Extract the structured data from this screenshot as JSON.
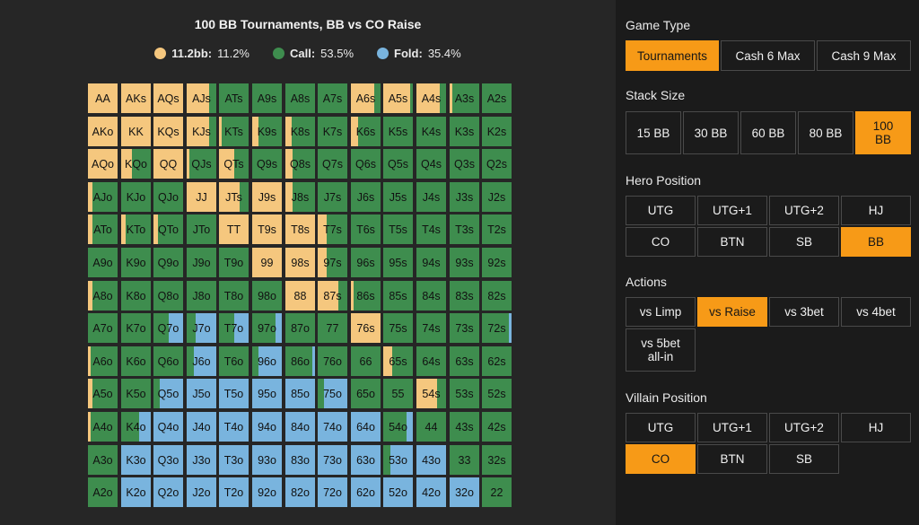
{
  "chart": {
    "title": "100 BB Tournaments, BB vs CO Raise",
    "legend": [
      {
        "name": "11.2bb:",
        "value": "11.2%",
        "color": "#f5c77e"
      },
      {
        "name": "Call:",
        "value": "53.5%",
        "color": "#3e8d4e"
      },
      {
        "name": "Fold:",
        "value": "35.4%",
        "color": "#79b4de"
      }
    ]
  },
  "colors": {
    "raise": "#f5c77e",
    "call": "#3e8d4e",
    "fold": "#79b4de",
    "accent": "#f79a17"
  },
  "grid": [
    [
      {
        "l": "AA",
        "r": 1,
        "c": 0
      },
      {
        "l": "AKs",
        "r": 1,
        "c": 0
      },
      {
        "l": "AQs",
        "r": 1,
        "c": 0
      },
      {
        "l": "AJs",
        "r": 0.75,
        "c": 0.25
      },
      {
        "l": "ATs",
        "r": 0,
        "c": 1
      },
      {
        "l": "A9s",
        "r": 0,
        "c": 1
      },
      {
        "l": "A8s",
        "r": 0,
        "c": 1
      },
      {
        "l": "A7s",
        "r": 0,
        "c": 1
      },
      {
        "l": "A6s",
        "r": 0.8,
        "c": 0.2
      },
      {
        "l": "A5s",
        "r": 0.9,
        "c": 0.1
      },
      {
        "l": "A4s",
        "r": 0.8,
        "c": 0.2
      },
      {
        "l": "A3s",
        "r": 0.1,
        "c": 0.9
      },
      {
        "l": "A2s",
        "r": 0,
        "c": 1
      }
    ],
    [
      {
        "l": "AKo",
        "r": 1,
        "c": 0
      },
      {
        "l": "KK",
        "r": 1,
        "c": 0
      },
      {
        "l": "KQs",
        "r": 1,
        "c": 0
      },
      {
        "l": "KJs",
        "r": 0.75,
        "c": 0.25
      },
      {
        "l": "KTs",
        "r": 0.1,
        "c": 0.9
      },
      {
        "l": "K9s",
        "r": 0.2,
        "c": 0.8
      },
      {
        "l": "K8s",
        "r": 0.2,
        "c": 0.8
      },
      {
        "l": "K7s",
        "r": 0,
        "c": 1
      },
      {
        "l": "K6s",
        "r": 0.25,
        "c": 0.75
      },
      {
        "l": "K5s",
        "r": 0,
        "c": 1
      },
      {
        "l": "K4s",
        "r": 0,
        "c": 1
      },
      {
        "l": "K3s",
        "r": 0,
        "c": 1
      },
      {
        "l": "K2s",
        "r": 0,
        "c": 1
      }
    ],
    [
      {
        "l": "AQo",
        "r": 1,
        "c": 0
      },
      {
        "l": "KQo",
        "r": 0.35,
        "c": 0.65
      },
      {
        "l": "QQ",
        "r": 1,
        "c": 0
      },
      {
        "l": "QJs",
        "r": 0.1,
        "c": 0.9
      },
      {
        "l": "QTs",
        "r": 0.5,
        "c": 0.5
      },
      {
        "l": "Q9s",
        "r": 0,
        "c": 1
      },
      {
        "l": "Q8s",
        "r": 0.25,
        "c": 0.75
      },
      {
        "l": "Q7s",
        "r": 0,
        "c": 1
      },
      {
        "l": "Q6s",
        "r": 0,
        "c": 1
      },
      {
        "l": "Q5s",
        "r": 0,
        "c": 1
      },
      {
        "l": "Q4s",
        "r": 0,
        "c": 1
      },
      {
        "l": "Q3s",
        "r": 0,
        "c": 1
      },
      {
        "l": "Q2s",
        "r": 0,
        "c": 1
      }
    ],
    [
      {
        "l": "AJo",
        "r": 0.15,
        "c": 0.85
      },
      {
        "l": "KJo",
        "r": 0,
        "c": 1
      },
      {
        "l": "QJo",
        "r": 0,
        "c": 1
      },
      {
        "l": "JJ",
        "r": 1,
        "c": 0
      },
      {
        "l": "JTs",
        "r": 0.7,
        "c": 0.3
      },
      {
        "l": "J9s",
        "r": 1,
        "c": 0
      },
      {
        "l": "J8s",
        "r": 0.25,
        "c": 0.75
      },
      {
        "l": "J7s",
        "r": 0,
        "c": 1
      },
      {
        "l": "J6s",
        "r": 0,
        "c": 1
      },
      {
        "l": "J5s",
        "r": 0,
        "c": 1
      },
      {
        "l": "J4s",
        "r": 0,
        "c": 1
      },
      {
        "l": "J3s",
        "r": 0,
        "c": 1
      },
      {
        "l": "J2s",
        "r": 0,
        "c": 1
      }
    ],
    [
      {
        "l": "ATo",
        "r": 0.15,
        "c": 0.85
      },
      {
        "l": "KTo",
        "r": 0.15,
        "c": 0.85
      },
      {
        "l": "QTo",
        "r": 0.15,
        "c": 0.85
      },
      {
        "l": "JTo",
        "r": 0,
        "c": 1
      },
      {
        "l": "TT",
        "r": 1,
        "c": 0
      },
      {
        "l": "T9s",
        "r": 1,
        "c": 0
      },
      {
        "l": "T8s",
        "r": 1,
        "c": 0
      },
      {
        "l": "T7s",
        "r": 0.3,
        "c": 0.7
      },
      {
        "l": "T6s",
        "r": 0,
        "c": 1
      },
      {
        "l": "T5s",
        "r": 0,
        "c": 1
      },
      {
        "l": "T4s",
        "r": 0,
        "c": 1
      },
      {
        "l": "T3s",
        "r": 0,
        "c": 1
      },
      {
        "l": "T2s",
        "r": 0,
        "c": 1
      }
    ],
    [
      {
        "l": "A9o",
        "r": 0,
        "c": 1
      },
      {
        "l": "K9o",
        "r": 0,
        "c": 1
      },
      {
        "l": "Q9o",
        "r": 0,
        "c": 1
      },
      {
        "l": "J9o",
        "r": 0,
        "c": 1
      },
      {
        "l": "T9o",
        "r": 0,
        "c": 1
      },
      {
        "l": "99",
        "r": 1,
        "c": 0
      },
      {
        "l": "98s",
        "r": 1,
        "c": 0
      },
      {
        "l": "97s",
        "r": 0.3,
        "c": 0.7
      },
      {
        "l": "96s",
        "r": 0,
        "c": 1
      },
      {
        "l": "95s",
        "r": 0,
        "c": 1
      },
      {
        "l": "94s",
        "r": 0,
        "c": 1
      },
      {
        "l": "93s",
        "r": 0,
        "c": 1
      },
      {
        "l": "92s",
        "r": 0,
        "c": 1
      }
    ],
    [
      {
        "l": "A8o",
        "r": 0.15,
        "c": 0.85
      },
      {
        "l": "K8o",
        "r": 0,
        "c": 1
      },
      {
        "l": "Q8o",
        "r": 0,
        "c": 1
      },
      {
        "l": "J8o",
        "r": 0,
        "c": 1
      },
      {
        "l": "T8o",
        "r": 0,
        "c": 1
      },
      {
        "l": "98o",
        "r": 0,
        "c": 1
      },
      {
        "l": "88",
        "r": 1,
        "c": 0
      },
      {
        "l": "87s",
        "r": 0.7,
        "c": 0.3
      },
      {
        "l": "86s",
        "r": 0.1,
        "c": 0.9
      },
      {
        "l": "85s",
        "r": 0,
        "c": 1
      },
      {
        "l": "84s",
        "r": 0,
        "c": 1
      },
      {
        "l": "83s",
        "r": 0,
        "c": 1
      },
      {
        "l": "82s",
        "r": 0,
        "c": 1
      }
    ],
    [
      {
        "l": "A7o",
        "r": 0,
        "c": 1
      },
      {
        "l": "K7o",
        "r": 0,
        "c": 1
      },
      {
        "l": "Q7o",
        "r": 0,
        "c": 0.5
      },
      {
        "l": "J7o",
        "r": 0,
        "c": 0.3
      },
      {
        "l": "T7o",
        "r": 0,
        "c": 0.5
      },
      {
        "l": "97o",
        "r": 0,
        "c": 0.8
      },
      {
        "l": "87o",
        "r": 0,
        "c": 1
      },
      {
        "l": "77",
        "r": 0,
        "c": 1
      },
      {
        "l": "76s",
        "r": 1,
        "c": 0
      },
      {
        "l": "75s",
        "r": 0,
        "c": 1
      },
      {
        "l": "74s",
        "r": 0,
        "c": 1
      },
      {
        "l": "73s",
        "r": 0,
        "c": 1
      },
      {
        "l": "72s",
        "r": 0,
        "c": 0.9
      }
    ],
    [
      {
        "l": "A6o",
        "r": 0.1,
        "c": 0.9
      },
      {
        "l": "K6o",
        "r": 0,
        "c": 1
      },
      {
        "l": "Q6o",
        "r": 0,
        "c": 1
      },
      {
        "l": "J6o",
        "r": 0,
        "c": 0.25
      },
      {
        "l": "T6o",
        "r": 0,
        "c": 1
      },
      {
        "l": "96o",
        "r": 0,
        "c": 0.2
      },
      {
        "l": "86o",
        "r": 0,
        "c": 0.9
      },
      {
        "l": "76o",
        "r": 0,
        "c": 1
      },
      {
        "l": "66",
        "r": 0,
        "c": 1
      },
      {
        "l": "65s",
        "r": 0.3,
        "c": 0.7
      },
      {
        "l": "64s",
        "r": 0,
        "c": 1
      },
      {
        "l": "63s",
        "r": 0,
        "c": 1
      },
      {
        "l": "62s",
        "r": 0,
        "c": 1
      }
    ],
    [
      {
        "l": "A5o",
        "r": 0.15,
        "c": 0.85
      },
      {
        "l": "K5o",
        "r": 0,
        "c": 1
      },
      {
        "l": "Q5o",
        "r": 0,
        "c": 0.2
      },
      {
        "l": "J5o",
        "r": 0,
        "c": 0
      },
      {
        "l": "T5o",
        "r": 0,
        "c": 0
      },
      {
        "l": "95o",
        "r": 0,
        "c": 0
      },
      {
        "l": "85o",
        "r": 0,
        "c": 0
      },
      {
        "l": "75o",
        "r": 0,
        "c": 0.2
      },
      {
        "l": "65o",
        "r": 0,
        "c": 1
      },
      {
        "l": "55",
        "r": 0,
        "c": 1
      },
      {
        "l": "54s",
        "r": 0.7,
        "c": 0.3
      },
      {
        "l": "53s",
        "r": 0,
        "c": 1
      },
      {
        "l": "52s",
        "r": 0,
        "c": 1
      }
    ],
    [
      {
        "l": "A4o",
        "r": 0.1,
        "c": 0.9
      },
      {
        "l": "K4o",
        "r": 0,
        "c": 0.6
      },
      {
        "l": "Q4o",
        "r": 0,
        "c": 0
      },
      {
        "l": "J4o",
        "r": 0,
        "c": 0
      },
      {
        "l": "T4o",
        "r": 0,
        "c": 0
      },
      {
        "l": "94o",
        "r": 0,
        "c": 0
      },
      {
        "l": "84o",
        "r": 0,
        "c": 0
      },
      {
        "l": "74o",
        "r": 0,
        "c": 0
      },
      {
        "l": "64o",
        "r": 0,
        "c": 0
      },
      {
        "l": "54o",
        "r": 0,
        "c": 0.8
      },
      {
        "l": "44",
        "r": 0,
        "c": 1
      },
      {
        "l": "43s",
        "r": 0,
        "c": 1
      },
      {
        "l": "42s",
        "r": 0,
        "c": 1
      }
    ],
    [
      {
        "l": "A3o",
        "r": 0,
        "c": 1
      },
      {
        "l": "K3o",
        "r": 0,
        "c": 0
      },
      {
        "l": "Q3o",
        "r": 0,
        "c": 0
      },
      {
        "l": "J3o",
        "r": 0,
        "c": 0
      },
      {
        "l": "T3o",
        "r": 0,
        "c": 0
      },
      {
        "l": "93o",
        "r": 0,
        "c": 0
      },
      {
        "l": "83o",
        "r": 0,
        "c": 0
      },
      {
        "l": "73o",
        "r": 0,
        "c": 0
      },
      {
        "l": "63o",
        "r": 0,
        "c": 0
      },
      {
        "l": "53o",
        "r": 0,
        "c": 0.25
      },
      {
        "l": "43o",
        "r": 0,
        "c": 0
      },
      {
        "l": "33",
        "r": 0,
        "c": 1
      },
      {
        "l": "32s",
        "r": 0,
        "c": 1
      }
    ],
    [
      {
        "l": "A2o",
        "r": 0,
        "c": 1
      },
      {
        "l": "K2o",
        "r": 0,
        "c": 0
      },
      {
        "l": "Q2o",
        "r": 0,
        "c": 0
      },
      {
        "l": "J2o",
        "r": 0,
        "c": 0
      },
      {
        "l": "T2o",
        "r": 0,
        "c": 0
      },
      {
        "l": "92o",
        "r": 0,
        "c": 0
      },
      {
        "l": "82o",
        "r": 0,
        "c": 0
      },
      {
        "l": "72o",
        "r": 0,
        "c": 0
      },
      {
        "l": "62o",
        "r": 0,
        "c": 0
      },
      {
        "l": "52o",
        "r": 0,
        "c": 0
      },
      {
        "l": "42o",
        "r": 0,
        "c": 0
      },
      {
        "l": "32o",
        "r": 0,
        "c": 0
      },
      {
        "l": "22",
        "r": 0,
        "c": 1
      }
    ]
  ],
  "panel": {
    "game_type": {
      "label": "Game Type",
      "options": [
        "Tournaments",
        "Cash 6 Max",
        "Cash 9 Max"
      ],
      "selected": 0
    },
    "stack_size": {
      "label": "Stack Size",
      "options": [
        "15 BB",
        "30 BB",
        "60 BB",
        "80 BB",
        "100 BB"
      ],
      "selected": 4
    },
    "hero_position": {
      "label": "Hero Position",
      "options": [
        "UTG",
        "UTG+1",
        "UTG+2",
        "HJ",
        "CO",
        "BTN",
        "SB",
        "BB"
      ],
      "selected": 7
    },
    "actions": {
      "label": "Actions",
      "options": [
        "vs Limp",
        "vs Raise",
        "vs 3bet",
        "vs 4bet",
        "vs 5bet all-in"
      ],
      "selected": 1
    },
    "villain_position": {
      "label": "Villain Position",
      "options": [
        "UTG",
        "UTG+1",
        "UTG+2",
        "HJ",
        "CO",
        "BTN",
        "SB"
      ],
      "selected": 4
    }
  }
}
